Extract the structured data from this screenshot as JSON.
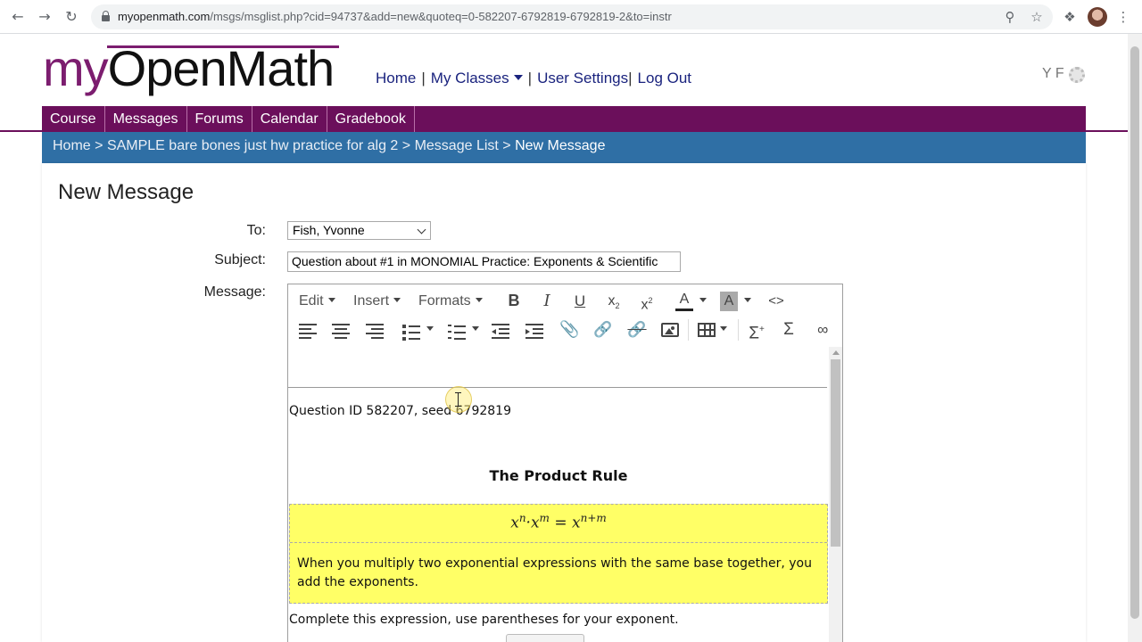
{
  "browser": {
    "url_host": "myopenmath.com",
    "url_path": "/msgs/msglist.php?cid=94737&add=new&quoteq=0-582207-6792819-6792819-2&to=instr"
  },
  "header": {
    "logo_my": "my",
    "logo_openmath": "OpenMath",
    "nav": {
      "home": "Home",
      "my_classes": "My Classes",
      "user_settings": "User Settings",
      "logout": "Log Out",
      "sep": "|"
    },
    "user_initials": "Y F"
  },
  "main_nav": [
    "Course",
    "Messages",
    "Forums",
    "Calendar",
    "Gradebook"
  ],
  "breadcrumb": {
    "home": "Home",
    "course": "SAMPLE bare bones just hw practice for alg 2",
    "list": "Message List",
    "current": "New Message",
    "sep": ">"
  },
  "form": {
    "title": "New Message",
    "to_label": "To:",
    "to_value": "Fish, Yvonne",
    "subject_label": "Subject:",
    "subject_value": "Question about #1 in MONOMIAL Practice:  Exponents & Scientific",
    "message_label": "Message:"
  },
  "editor": {
    "menus": {
      "edit": "Edit",
      "insert": "Insert",
      "formats": "Formats"
    },
    "tool_glyphs": {
      "bold": "B",
      "italic": "I",
      "underline": "U",
      "subscript": "x",
      "superscript": "x",
      "text_color": "A",
      "bg_color": "A",
      "code": "<>",
      "sum": "Σ"
    },
    "content": {
      "question_id": "Question ID 582207, seed 6792819",
      "heading": "The Product Rule",
      "formula_base": "x",
      "formula_exp1": "n",
      "formula_exp2": "m",
      "formula_result_exp": "n+m",
      "explanation": "When you multiply two exponential expressions with the same base together, you add the exponents.",
      "instruction": "Complete this expression, use parentheses for your exponent."
    }
  },
  "colors": {
    "brand_purple": "#6b0f5b",
    "breadcrumb_blue": "#2f6fa5",
    "highlight_yellow": "#ffff66"
  }
}
